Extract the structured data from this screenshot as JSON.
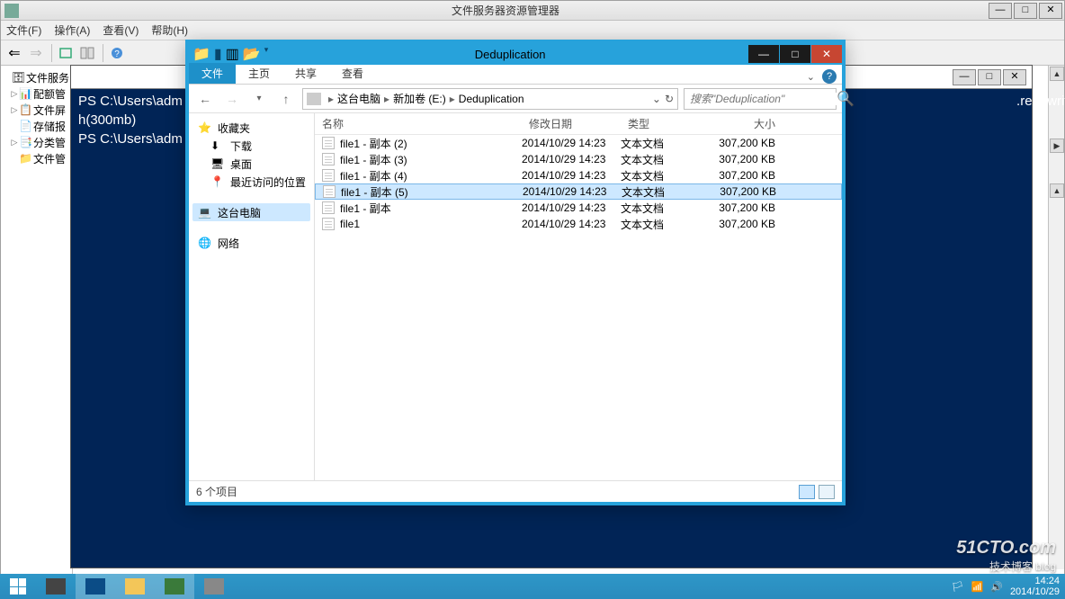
{
  "fsrm": {
    "title": "文件服务器资源管理器",
    "menu": {
      "file": "文件(F)",
      "action": "操作(A)",
      "view": "查看(V)",
      "help": "帮助(H)"
    },
    "tree": {
      "root": "文件服务",
      "n1": "配额管",
      "n2": "文件屏",
      "n3": "存储报",
      "n4": "分类管",
      "n5": "文件管"
    }
  },
  "ps": {
    "line1": "PS C:\\Users\\adm",
    "line1b": ".readwrite).setlengt",
    "line2": "h(300mb)",
    "line3": "PS C:\\Users\\adm"
  },
  "explorer": {
    "title": "Deduplication",
    "ribbon": {
      "file": "文件",
      "home": "主页",
      "share": "共享",
      "view": "查看"
    },
    "breadcrumb": {
      "pc": "这台电脑",
      "drive": "新加卷 (E:)",
      "folder": "Deduplication"
    },
    "search_placeholder": "搜索\"Deduplication\"",
    "nav": {
      "fav": "收藏夹",
      "dl": "下载",
      "desk": "桌面",
      "recent": "最近访问的位置",
      "pc": "这台电脑",
      "net": "网络"
    },
    "columns": {
      "name": "名称",
      "date": "修改日期",
      "type": "类型",
      "size": "大小"
    },
    "files": [
      {
        "name": "file1 - 副本 (2)",
        "date": "2014/10/29 14:23",
        "type": "文本文档",
        "size": "307,200 KB"
      },
      {
        "name": "file1 - 副本 (3)",
        "date": "2014/10/29 14:23",
        "type": "文本文档",
        "size": "307,200 KB"
      },
      {
        "name": "file1 - 副本 (4)",
        "date": "2014/10/29 14:23",
        "type": "文本文档",
        "size": "307,200 KB"
      },
      {
        "name": "file1 - 副本 (5)",
        "date": "2014/10/29 14:23",
        "type": "文本文档",
        "size": "307,200 KB",
        "selected": true
      },
      {
        "name": "file1 - 副本",
        "date": "2014/10/29 14:23",
        "type": "文本文档",
        "size": "307,200 KB"
      },
      {
        "name": "file1",
        "date": "2014/10/29 14:23",
        "type": "文本文档",
        "size": "307,200 KB"
      }
    ],
    "status": "6 个项目"
  },
  "tray": {
    "time": "14:24",
    "date": "2014/10/29"
  },
  "watermark": {
    "l1": "51CTO.com",
    "l2": "技术博客   blog"
  }
}
